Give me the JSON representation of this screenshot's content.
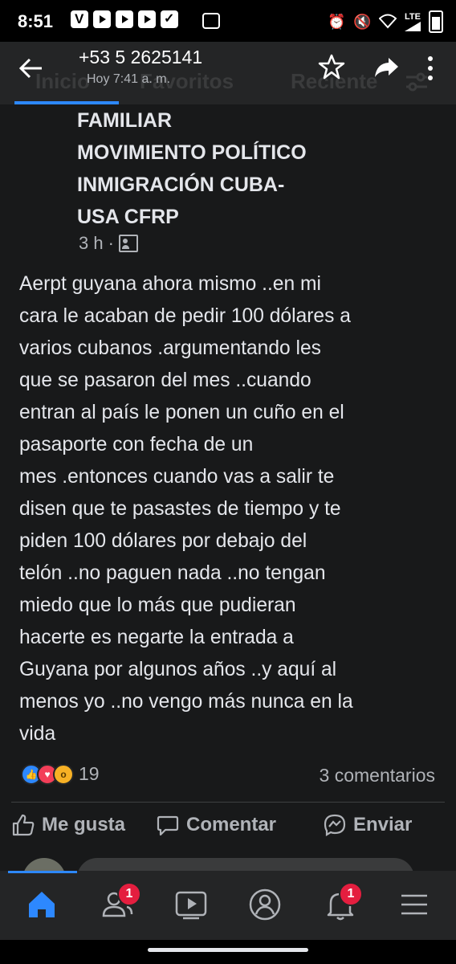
{
  "status_bar": {
    "time": "8:51",
    "network": "LTE",
    "icons": [
      "voicemail-icon",
      "youtube-icon",
      "youtube-icon",
      "youtube-icon",
      "check-icon",
      "gallery-icon",
      "alarm-icon",
      "mute-icon",
      "wifi-icon",
      "signal-icon",
      "battery-icon"
    ]
  },
  "header": {
    "phone": "+53 5 2625141",
    "time": "Hoy 7:41 a. m.",
    "background_tabs": [
      "Inicio",
      "Favoritos",
      "Reciente"
    ]
  },
  "post": {
    "group_name_lines": [
      "FAMILIAR",
      "MOVIMIENTO POLÍTICO",
      "INMIGRACIÓN CUBA-",
      "USA CFRP"
    ],
    "time_ago": "3 h",
    "separator": "·",
    "text_lines": [
      "Aerpt guyana ahora mismo ..en mi",
      "cara le acaban de pedir 100 dólares a",
      "varios cubanos .argumentando les",
      "que se pasaron del mes ..cuando",
      "entran al país le ponen un cuño en el",
      "pasaporte  con fecha de un",
      "mes .entonces cuando vas a salir te",
      "disen que te pasastes de tiempo y te",
      "piden 100 dólares por debajo del",
      "telón ..no paguen nada ..no tengan",
      "miedo que lo más que pudieran",
      "hacerte es negarte la entrada a",
      "Guyana por algunos años ..y aquí al",
      "menos yo ..no vengo más nunca en la",
      "vida"
    ],
    "reaction_count": "19",
    "comments_count": "3 comentarios"
  },
  "actions": {
    "like": "Me gusta",
    "comment": "Comentar",
    "send": "Enviar"
  },
  "bottom_nav": {
    "friends_badge": "1",
    "notifications_badge": "1"
  },
  "colors": {
    "accent": "#2d88ff",
    "badge": "#e41e3f",
    "background": "#18191a",
    "surface": "#242526"
  }
}
